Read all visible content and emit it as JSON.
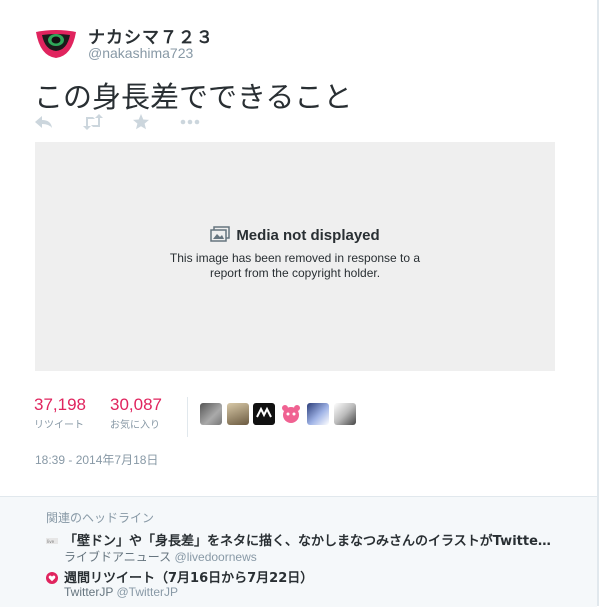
{
  "user": {
    "display_name": "ナカシマ７２３",
    "handle": "@nakashima723"
  },
  "tweet": {
    "text": "この身長差でできること",
    "timestamp": "18:39 - 2014年7月18日"
  },
  "actions": {
    "icons": [
      "reply-icon",
      "retweet-icon",
      "favorite-icon",
      "more-icon"
    ]
  },
  "media": {
    "title": "Media not displayed",
    "message_line1": "This image has been removed in response to a",
    "message_line2": "report from the copyright holder."
  },
  "stats": {
    "retweets": {
      "count": "37,198",
      "label": "リツイート"
    },
    "favorites": {
      "count": "30,087",
      "label": "お気に入り"
    }
  },
  "related": {
    "title": "関連のヘッドライン",
    "items": [
      {
        "headline": "「壁ドン」や「身長差」をネタに描く、なかしまなつみさんのイラストがTwitte…",
        "source_name": "ライブドアニュース",
        "source_handle": "@livedoornews"
      },
      {
        "headline": "週間リツイート（7月16日から7月22日）",
        "source_name": "TwitterJP",
        "source_handle": "@TwitterJP"
      }
    ]
  },
  "colors": {
    "accent_count": "#e0245e",
    "muted": "#8899a6",
    "media_bg": "#efefef"
  }
}
